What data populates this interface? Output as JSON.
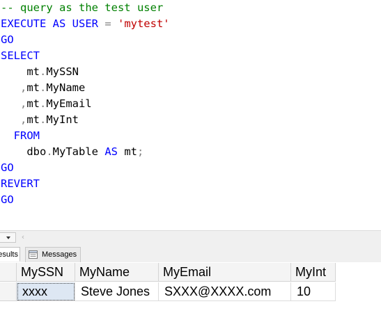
{
  "editor": {
    "lines": [
      {
        "name": "comment-line",
        "segments": [
          {
            "cls": "cm",
            "text": "-- query as the test user"
          }
        ]
      },
      {
        "name": "execute-as-line",
        "segments": [
          {
            "cls": "kw",
            "text": "EXECUTE AS USER "
          },
          {
            "cls": "gr",
            "text": "= "
          },
          {
            "cls": "str",
            "text": "'mytest'"
          }
        ]
      },
      {
        "name": "go-line-1",
        "segments": [
          {
            "cls": "kw",
            "text": "GO"
          }
        ]
      },
      {
        "name": "select-line",
        "segments": [
          {
            "cls": "kw",
            "text": "SELECT"
          }
        ]
      },
      {
        "name": "column-myssn-line",
        "segments": [
          {
            "cls": "pl",
            "text": "    mt"
          },
          {
            "cls": "gr",
            "text": "."
          },
          {
            "cls": "pl",
            "text": "MySSN"
          }
        ]
      },
      {
        "name": "column-myname-line",
        "segments": [
          {
            "cls": "gr",
            "text": "   ,"
          },
          {
            "cls": "pl",
            "text": "mt"
          },
          {
            "cls": "gr",
            "text": "."
          },
          {
            "cls": "pl",
            "text": "MyName"
          }
        ]
      },
      {
        "name": "column-myemail-line",
        "segments": [
          {
            "cls": "gr",
            "text": "   ,"
          },
          {
            "cls": "pl",
            "text": "mt"
          },
          {
            "cls": "gr",
            "text": "."
          },
          {
            "cls": "pl",
            "text": "MyEmail"
          }
        ]
      },
      {
        "name": "column-myint-line",
        "segments": [
          {
            "cls": "gr",
            "text": "   ,"
          },
          {
            "cls": "pl",
            "text": "mt"
          },
          {
            "cls": "gr",
            "text": "."
          },
          {
            "cls": "pl",
            "text": "MyInt"
          }
        ]
      },
      {
        "name": "from-line",
        "segments": [
          {
            "cls": "kw",
            "text": "  FROM"
          }
        ]
      },
      {
        "name": "table-line",
        "segments": [
          {
            "cls": "pl",
            "text": "    dbo"
          },
          {
            "cls": "gr",
            "text": "."
          },
          {
            "cls": "pl",
            "text": "MyTable "
          },
          {
            "cls": "kw",
            "text": "AS"
          },
          {
            "cls": "pl",
            "text": " mt"
          },
          {
            "cls": "gr",
            "text": ";"
          }
        ]
      },
      {
        "name": "go-line-2",
        "segments": [
          {
            "cls": "kw",
            "text": "GO"
          }
        ]
      },
      {
        "name": "revert-line",
        "segments": [
          {
            "cls": "kw",
            "text": "REVERT"
          }
        ]
      },
      {
        "name": "go-line-3",
        "segments": [
          {
            "cls": "kw",
            "text": "GO"
          }
        ]
      }
    ]
  },
  "tabs": {
    "results": "esults",
    "messages": "Messages"
  },
  "results": {
    "columns": [
      "MySSN",
      "MyName",
      "MyEmail",
      "MyInt"
    ],
    "rows": [
      [
        "xxxx",
        "Steve Jones",
        "SXXX@XXXX.com",
        "10"
      ]
    ]
  },
  "colors": {
    "keyword": "#0000ff",
    "comment": "#008000",
    "string": "#c00000",
    "selection": "#dde7f3"
  }
}
